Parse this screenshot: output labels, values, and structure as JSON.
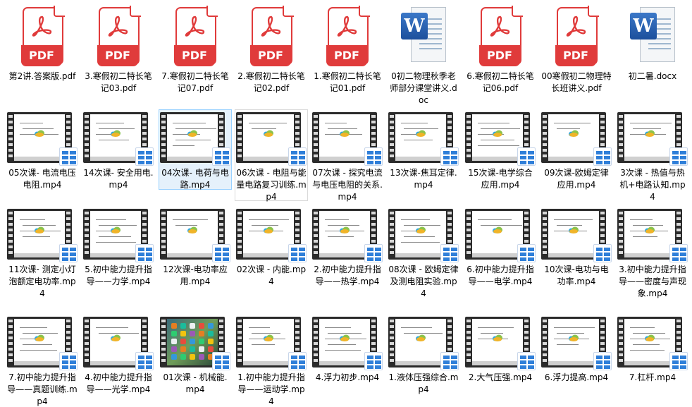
{
  "colors": {
    "pdf_red": "#e03b3b",
    "word_blue": "#2a6ac0",
    "selection": "#e5f1fb",
    "video_badge": "#2f7fd9"
  },
  "rows": [
    [
      {
        "type": "pdf",
        "icon": "pdf-icon",
        "label": "第2讲.答案版.pdf"
      },
      {
        "type": "pdf",
        "icon": "pdf-icon",
        "label": "3.寒假初二特长笔记03.pdf"
      },
      {
        "type": "pdf",
        "icon": "pdf-icon",
        "label": "7.寒假初二特长笔记07.pdf"
      },
      {
        "type": "pdf",
        "icon": "pdf-icon",
        "label": "2.寒假初二特长笔记02.pdf"
      },
      {
        "type": "pdf",
        "icon": "pdf-icon",
        "label": "1.寒假初二特长笔记01.pdf"
      },
      {
        "type": "doc",
        "icon": "word-icon",
        "label": "0初二物理秋季老师部分课堂讲义.doc"
      },
      {
        "type": "pdf",
        "icon": "pdf-icon",
        "label": "6.寒假初二特长笔记06.pdf"
      },
      {
        "type": "pdf",
        "icon": "pdf-icon",
        "label": "00寒假初二物理特长班讲义.pdf"
      },
      {
        "type": "docx",
        "icon": "word-icon",
        "label": "初二暑.docx"
      }
    ],
    [
      {
        "type": "mp4",
        "icon": "video-icon",
        "label": "05次课- 电流电压电阻.mp4"
      },
      {
        "type": "mp4",
        "icon": "video-icon",
        "label": "14次课- 安全用电.mp4"
      },
      {
        "type": "mp4",
        "icon": "video-icon",
        "label": "04次课- 电荷与电路.mp4",
        "state": "selected"
      },
      {
        "type": "mp4",
        "icon": "video-icon",
        "label": "06次课 - 电阻与能量电路复习训练.mp4",
        "state": "hovered"
      },
      {
        "type": "mp4",
        "icon": "video-icon",
        "label": "07次课 - 探究电流与电压电阻的关系.mp4"
      },
      {
        "type": "mp4",
        "icon": "video-icon",
        "label": "13次课-焦耳定律.mp4"
      },
      {
        "type": "mp4",
        "icon": "video-icon",
        "label": "15次课-电学综合应用.mp4"
      },
      {
        "type": "mp4",
        "icon": "video-icon",
        "label": "09次课-欧姆定律应用.mp4"
      },
      {
        "type": "mp4",
        "icon": "video-icon",
        "label": "3次课 - 热值与热机+电路认知.mp4"
      }
    ],
    [
      {
        "type": "mp4",
        "icon": "video-icon",
        "label": "11次课- 测定小灯泡额定电功率.mp4"
      },
      {
        "type": "mp4",
        "icon": "video-icon",
        "label": "5.初中能力提升指导——力学.mp4"
      },
      {
        "type": "mp4",
        "icon": "video-icon",
        "label": "12次课-电功率应用.mp4"
      },
      {
        "type": "mp4",
        "icon": "video-icon",
        "label": "02次课 - 内能.mp4"
      },
      {
        "type": "mp4",
        "icon": "video-icon",
        "label": "2.初中能力提升指导——热学.mp4"
      },
      {
        "type": "mp4",
        "icon": "video-icon",
        "label": "08次课 - 欧姆定律及测电阻实验.mp4"
      },
      {
        "type": "mp4",
        "icon": "video-icon",
        "label": "6.初中能力提升指导——电学.mp4"
      },
      {
        "type": "mp4",
        "icon": "video-icon",
        "label": "10次课-电功与电功率.mp4"
      },
      {
        "type": "mp4",
        "icon": "video-icon",
        "label": "3.初中能力提升指导——密度与声现象.mp4"
      }
    ],
    [
      {
        "type": "mp4",
        "icon": "video-icon",
        "label": "7.初中能力提升指导——真题训练.mp4"
      },
      {
        "type": "mp4",
        "icon": "video-icon",
        "label": "4.初中能力提升指导——光学.mp4"
      },
      {
        "type": "mp4",
        "icon": "video-icon",
        "label": "01次课 - 机械能.mp4",
        "thumb": "ipad"
      },
      {
        "type": "mp4",
        "icon": "video-icon",
        "label": "1.初中能力提升指导——运动学.mp4"
      },
      {
        "type": "mp4",
        "icon": "video-icon",
        "label": "4.浮力初步.mp4"
      },
      {
        "type": "mp4",
        "icon": "video-icon",
        "label": "1.液体压强综合.mp4"
      },
      {
        "type": "mp4",
        "icon": "video-icon",
        "label": "2.大气压强.mp4"
      },
      {
        "type": "mp4",
        "icon": "video-icon",
        "label": "6.浮力提高.mp4"
      },
      {
        "type": "mp4",
        "icon": "video-icon",
        "label": "7.杠杆.mp4"
      }
    ]
  ]
}
